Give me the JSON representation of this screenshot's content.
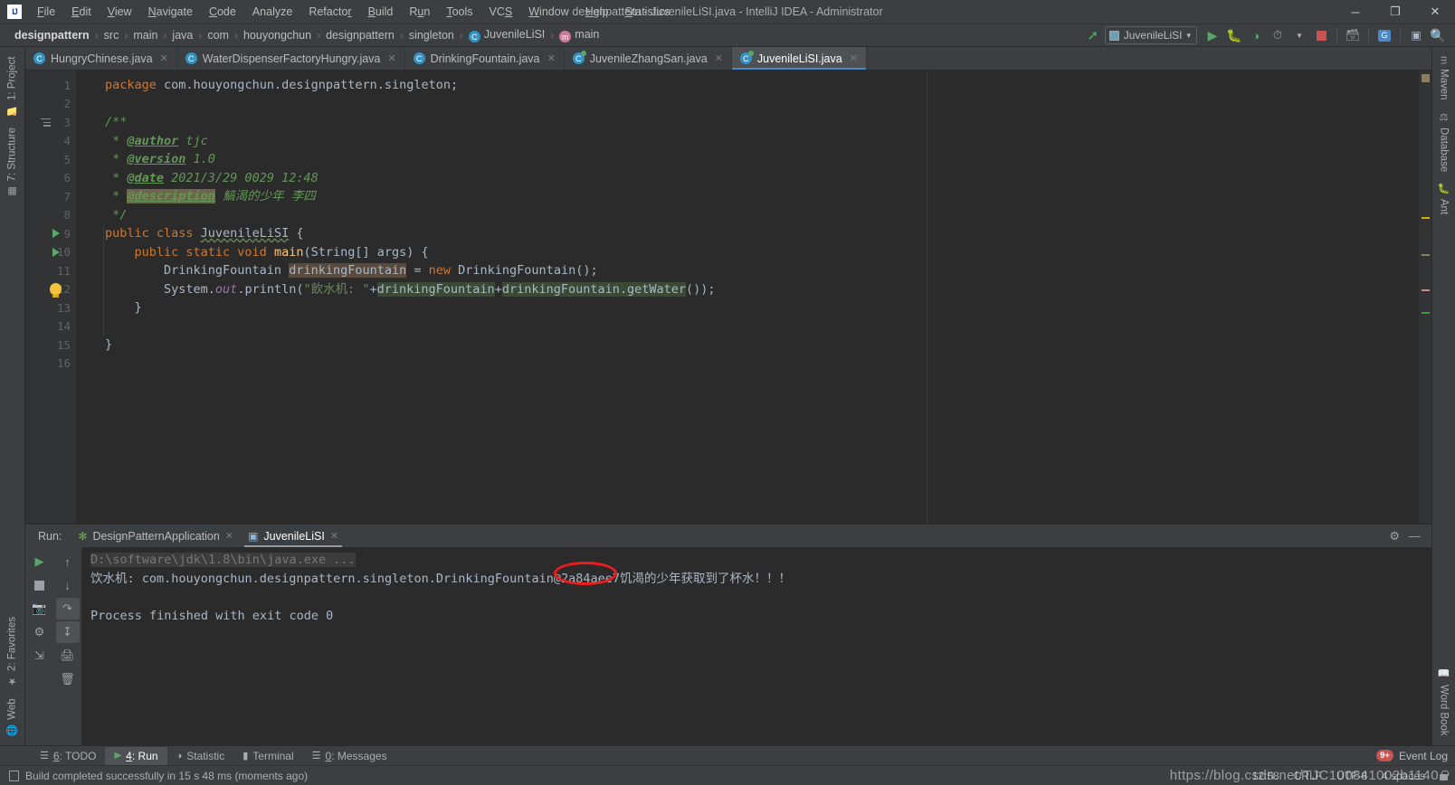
{
  "titlebar": {
    "logo": "IJ",
    "window_title": "designpattern - JuvenileLiSI.java - IntelliJ IDEA - Administrator",
    "menus": [
      "File",
      "Edit",
      "View",
      "Navigate",
      "Code",
      "Analyze",
      "Refactor",
      "Build",
      "Run",
      "Tools",
      "VCS",
      "Window",
      "Help",
      "Statistics"
    ],
    "minimize": "─",
    "maximize": "❐",
    "close": "✕"
  },
  "navbar": {
    "breadcrumbs": [
      "designpattern",
      "src",
      "main",
      "java",
      "com",
      "houyongchun",
      "designpattern",
      "singleton",
      "JuvenileLiSI",
      "main"
    ],
    "separator": "›",
    "run_config": "JuvenileLiSI",
    "dropdown_arrow": "▾",
    "icons": [
      "build-hammer-icon",
      "run-icon",
      "debug-icon",
      "run-coverage-icon",
      "profile-icon",
      "stop-icon",
      "project-structure-icon",
      "translate-icon",
      "screen-icon",
      "search-icon"
    ]
  },
  "editor_tabs": [
    {
      "label": "HungryChinese.java",
      "active": false,
      "runnable": false
    },
    {
      "label": "WaterDispenserFactoryHungry.java",
      "active": false,
      "runnable": false
    },
    {
      "label": "DrinkingFountain.java",
      "active": false,
      "runnable": false
    },
    {
      "label": "JuvenileZhangSan.java",
      "active": false,
      "runnable": true
    },
    {
      "label": "JuvenileLiSI.java",
      "active": true,
      "runnable": true
    }
  ],
  "left_stripe": [
    {
      "label": "1: Project",
      "icon": "folder-icon"
    },
    {
      "label": "7: Structure",
      "icon": "structure-icon"
    },
    {
      "label": "2: Favorites",
      "icon": "star-icon"
    },
    {
      "label": "Web",
      "icon": "globe-icon"
    }
  ],
  "right_stripe": [
    {
      "label": "Maven",
      "icon": "maven-icon"
    },
    {
      "label": "Database",
      "icon": "database-icon"
    },
    {
      "label": "Ant",
      "icon": "ant-icon"
    },
    {
      "label": "Word Book",
      "icon": "book-icon"
    }
  ],
  "code": {
    "line_numbers": [
      1,
      2,
      3,
      4,
      5,
      6,
      7,
      8,
      9,
      10,
      11,
      12,
      13,
      14,
      15,
      16
    ],
    "lines": [
      "package com.houyongchun.designpattern.singleton;",
      "",
      "/**",
      " * @author tjc",
      " * @version 1.0",
      " * @date 2021/3/29 0029 12:48",
      " * @description 饥渴的少年 李四",
      " */",
      "public class JuvenileLiSI {",
      "    public static void main(String[] args) {",
      "        DrinkingFountain drinkingFountain = new DrinkingFountain();",
      "        System.out.println(\"饮水机: \"+drinkingFountain+drinkingFountain.getWater());",
      "    }",
      "",
      "}",
      ""
    ]
  },
  "run_panel": {
    "label": "Run:",
    "tabs": [
      {
        "label": "DesignPatternApplication",
        "active": false,
        "icon": "spring-icon"
      },
      {
        "label": "JuvenileLiSI",
        "active": true,
        "icon": "console-icon"
      }
    ],
    "settings_icon": "gear-icon",
    "minimize_icon": "minimize-icon",
    "toolbar_left": [
      "rerun-icon",
      "stop-icon",
      "camera-icon",
      "thread-dump-icon",
      "export-icon"
    ],
    "toolbar_right": [
      "scroll-up-icon",
      "scroll-down-icon",
      "soft-wrap-icon",
      "scroll-to-end-icon",
      "print-icon",
      "trash-icon"
    ],
    "console_lines": [
      "D:\\software\\jdk\\1.8\\bin\\java.exe ...",
      "饮水机: com.houyongchun.designpattern.singleton.DrinkingFountain@2a84aee7饥渴的少年获取到了杯水！！！",
      "",
      "Process finished with exit code 0"
    ],
    "annotation": "red-ellipse-around-@2a84aee7"
  },
  "bottom_tabs": [
    {
      "label": "6: TODO",
      "icon": "todo-icon",
      "active": false
    },
    {
      "label": "4: Run",
      "icon": "run-icon",
      "active": true
    },
    {
      "label": "Statistic",
      "icon": "statistic-icon",
      "active": false
    },
    {
      "label": "Terminal",
      "icon": "terminal-icon",
      "active": false
    },
    {
      "label": "0: Messages",
      "icon": "messages-icon",
      "active": false
    }
  ],
  "event_log": {
    "label": "Event Log",
    "badge": "9+"
  },
  "statusbar": {
    "build_message": "Build completed successfully in 15 s 48 ms (moments ago)",
    "time": "12:58",
    "line_separator": "CRLF",
    "encoding": "UTF-8",
    "indent": "4 spaces"
  },
  "watermark": {
    "text": "https://blog.csdn.net/TJC100841002b1140"
  },
  "colors": {
    "bg": "#3c3f41",
    "editor_bg": "#2b2b2b",
    "accent_blue": "#4a88c7",
    "keyword": "#cc7832",
    "string": "#6a8759",
    "comment": "#629755",
    "annotation_red": "#ee1c1c",
    "run_green": "#59a869"
  }
}
